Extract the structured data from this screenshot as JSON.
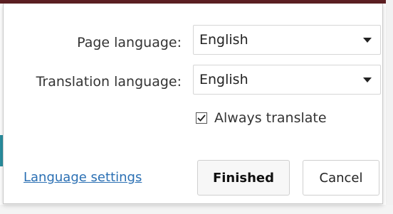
{
  "dialog": {
    "page_language_label": "Page language:",
    "page_language_value": "English",
    "translation_language_label": "Translation language:",
    "translation_language_value": "English",
    "always_translate_label": "Always translate",
    "always_translate_checked": true,
    "language_settings_link": "Language settings",
    "finished_button": "Finished",
    "cancel_button": "Cancel"
  },
  "colors": {
    "link": "#2a6fb3",
    "chrome_top": "#5c1f22",
    "accent": "#2a8fa0"
  },
  "icons": {
    "dropdown": "caret-down-icon",
    "check": "checkmark-icon"
  }
}
